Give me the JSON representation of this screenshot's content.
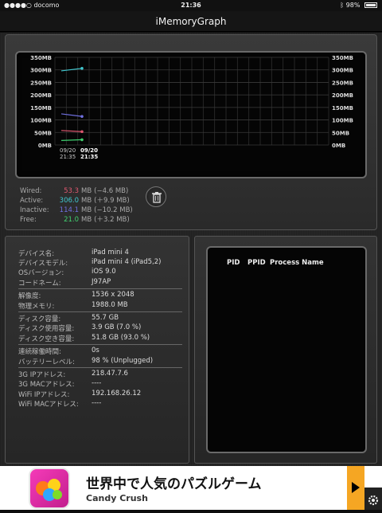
{
  "status_bar": {
    "carrier": "●●●●○ docomo",
    "time": "21:36",
    "battery": "98%"
  },
  "nav": {
    "title": "iMemoryGraph"
  },
  "graph": {
    "y_ticks": [
      "350MB",
      "300MB",
      "250MB",
      "200MB",
      "150MB",
      "100MB",
      "50MB",
      "0MB"
    ],
    "x_labels": [
      {
        "date": "09/20",
        "time": "21:35"
      },
      {
        "date": "09/20",
        "time": "21:35"
      }
    ]
  },
  "chart_data": {
    "type": "line",
    "x": [
      "21:35",
      "21:35"
    ],
    "ylim": [
      0,
      350
    ],
    "series": [
      {
        "name": "Active",
        "color": "#40c8d0",
        "values": [
          296.1,
          306.0
        ]
      },
      {
        "name": "Inactive",
        "color": "#7070e0",
        "values": [
          124.3,
          114.1
        ]
      },
      {
        "name": "Wired",
        "color": "#e05870",
        "values": [
          57.9,
          53.3
        ]
      },
      {
        "name": "Free",
        "color": "#40d070",
        "values": [
          17.8,
          21.0
        ]
      }
    ]
  },
  "memory": [
    {
      "label": "Wired:",
      "value": "53.3",
      "unit": "MB",
      "delta": "(−4.6 MB)",
      "color": "#e05870"
    },
    {
      "label": "Active:",
      "value": "306.0",
      "unit": "MB",
      "delta": "(＋9.9 MB)",
      "color": "#40c8d0"
    },
    {
      "label": "Inactive:",
      "value": "114.1",
      "unit": "MB",
      "delta": "(−10.2 MB)",
      "color": "#7070e0"
    },
    {
      "label": "Free:",
      "value": "21.0",
      "unit": "MB",
      "delta": "(＋3.2 MB)",
      "color": "#40d070"
    }
  ],
  "device_info": [
    {
      "key": "デバイス名:",
      "value": "iPad mini 4"
    },
    {
      "key": "デバイスモデル:",
      "value": "iPad mini 4 (iPad5,2)"
    },
    {
      "key": "OSバージョン:",
      "value": "iOS 9.0"
    },
    {
      "key": "コードネーム:",
      "value": "J97AP"
    },
    {
      "key": "解像度:",
      "value": "1536 x 2048"
    },
    {
      "key": "物理メモリ:",
      "value": "1988.0 MB"
    },
    {
      "key": "ディスク容量:",
      "value": "55.7 GB"
    },
    {
      "key": "ディスク使用容量:",
      "value": "3.9 GB (7.0 %)"
    },
    {
      "key": "ディスク空き容量:",
      "value": "51.8 GB (93.0 %)"
    },
    {
      "key": "連続稼働時間:",
      "value": "0s"
    },
    {
      "key": "バッテリーレベル:",
      "value": "98 % (Unplugged)"
    },
    {
      "key": "3G IPアドレス:",
      "value": "218.47.7.6"
    },
    {
      "key": "3G MACアドレス:",
      "value": "----"
    },
    {
      "key": "WiFi IPアドレス:",
      "value": "192.168.26.12"
    },
    {
      "key": "WiFi MACアドレス:",
      "value": "----"
    }
  ],
  "process": {
    "pid": "PID",
    "ppid": "PPID",
    "name": "Process Name"
  },
  "ad": {
    "title": "世界中で人気のパズルゲーム",
    "subtitle": "Candy Crush"
  },
  "icons": {
    "trash": "trash-icon",
    "wifi": "wifi-icon",
    "bluetooth": "bluetooth-icon",
    "gear": "gear-icon",
    "info": "info-icon"
  }
}
